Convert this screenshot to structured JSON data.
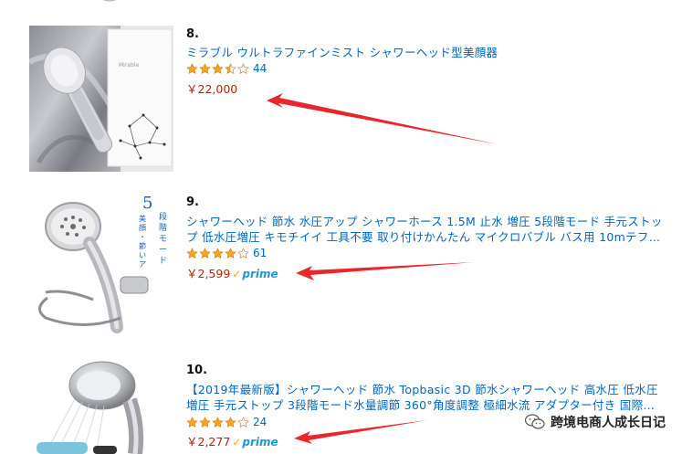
{
  "products": [
    {
      "rank": "8.",
      "title": "ミラブル ウルトラファインミスト シャワーヘッド型美顔器",
      "stars": 3.5,
      "review_count": "44",
      "price": "￥22,000",
      "prime": false,
      "thumbnail_icon": "mirable-shower-head-boxed-product-image"
    },
    {
      "rank": "9.",
      "title": "シャワーヘッド 節水 水圧アップ シャワーホース 1.5M 止水 増圧 5段階モード 手元ストップ 低水圧増圧 キモチイイ 工具不要 取り付けかんたん マイクロバブル バス用 10mテフ…",
      "stars": 4,
      "review_count": "61",
      "price": "￥2,599",
      "prime": true,
      "prime_label": "prime",
      "thumbnail_icon": "shower-head-with-hose-product-image",
      "thumbnail_text": [
        "5",
        "段",
        "階",
        "モ",
        "ー",
        "ド"
      ],
      "thumbnail_subtext": "美顔・節いアップ"
    },
    {
      "rank": "10.",
      "title": "【2019年最新版】シャワーヘッド 節水 Topbasic 3D 節水シャワーヘッド 高水圧 低水圧増圧 手元ストップ 3段階モード水量調節 360°角度調整 極細水流 アダプター付き 国際汎…",
      "stars": 4,
      "review_count": "24",
      "price": "￥2,277",
      "prime": true,
      "prime_label": "prime",
      "thumbnail_icon": "chrome-shower-head-product-image"
    }
  ],
  "watermark": {
    "text": "跨境电商人成长日记",
    "icon": "wechat-icon"
  },
  "colors": {
    "link": "#0066c0",
    "price": "#b12704",
    "star": "#f7a51b",
    "prime": "#1a98d5",
    "annotation_arrow": "#e8262b"
  }
}
